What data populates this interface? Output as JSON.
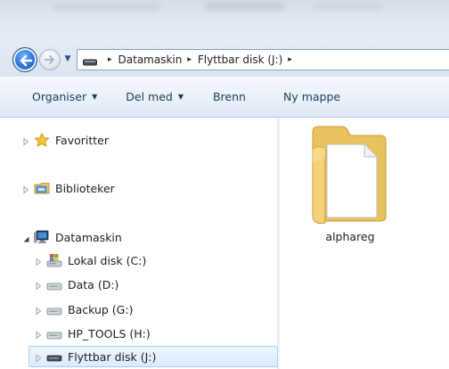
{
  "address": {
    "crumbs": [
      "Datamaskin",
      "Flyttbar disk (J:)"
    ],
    "separator": "▸"
  },
  "toolbar": {
    "organise_label": "Organiser",
    "share_label": "Del med",
    "burn_label": "Brenn",
    "new_folder_label": "Ny mappe",
    "dropdown_glyph": "▼"
  },
  "navpane": {
    "favorites": "Favoritter",
    "libraries": "Biblioteker",
    "computer": "Datamaskin",
    "drives": [
      {
        "label": "Lokal disk (C:)",
        "icon": "system-drive-icon"
      },
      {
        "label": "Data (D:)",
        "icon": "hard-drive-icon"
      },
      {
        "label": "Backup (G:)",
        "icon": "hard-drive-icon"
      },
      {
        "label": "HP_TOOLS (H:)",
        "icon": "hard-drive-icon"
      },
      {
        "label": "Flyttbar disk (J:)",
        "icon": "removable-drive-icon",
        "selected": true
      }
    ]
  },
  "content": {
    "items": [
      {
        "name": "alphareg",
        "type": "folder"
      }
    ]
  },
  "colors": {
    "accent": "#1e395b",
    "selection_bg": "#dcebfc",
    "selection_border": "#a9d0f5",
    "folder": "#f3d27a"
  }
}
